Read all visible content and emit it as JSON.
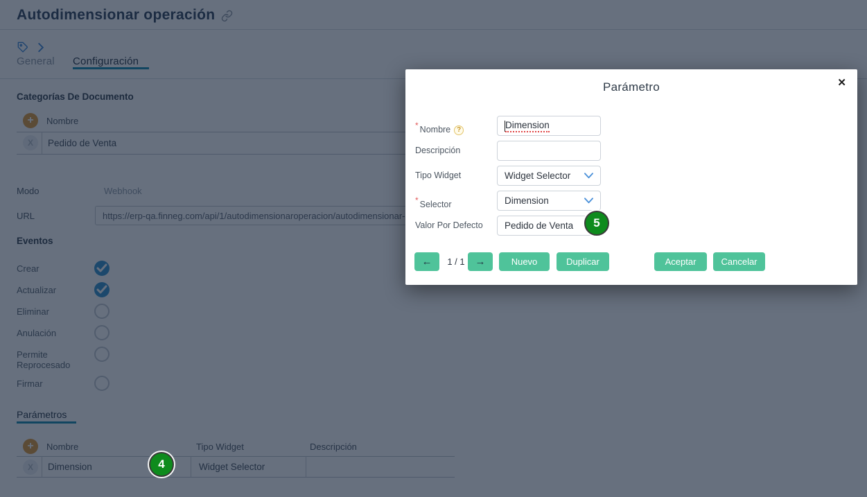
{
  "page": {
    "title": "Autodimensionar operación",
    "tabs": {
      "general": "General",
      "configuracion": "Configuración"
    },
    "doc_categories": {
      "section_title": "Categorías De Documento",
      "columns": {
        "nombre": "Nombre"
      },
      "rows": [
        {
          "nombre": "Pedido de Venta"
        }
      ]
    },
    "fields": {
      "modo_label": "Modo",
      "modo_value": "Webhook",
      "url_label": "URL",
      "url_value": "https://erp-qa.finneg.com/api/1/autodimensionaroperacion/autodimensionar-"
    },
    "eventos": {
      "section_title": "Eventos",
      "items": [
        {
          "label": "Crear",
          "checked": true
        },
        {
          "label": "Actualizar",
          "checked": true
        },
        {
          "label": "Eliminar",
          "checked": false
        },
        {
          "label": "Anulación",
          "checked": false
        },
        {
          "label": "Permite Reprocesado",
          "checked": false
        },
        {
          "label": "Firmar",
          "checked": false
        }
      ]
    },
    "parametros": {
      "section_title": "Parámetros",
      "columns": {
        "nombre": "Nombre",
        "tipo_widget": "Tipo Widget",
        "descripcion": "Descripción"
      },
      "rows": [
        {
          "nombre": "Dimension",
          "tipo_widget": "Widget Selector",
          "descripcion": ""
        }
      ]
    },
    "icons": {
      "plus": "+",
      "delete": "X"
    }
  },
  "modal": {
    "title": "Parámetro",
    "close_label": "✕",
    "required_marker": "*",
    "help_icon": "?",
    "fields": {
      "nombre": {
        "label": "Nombre",
        "value": "Dimension"
      },
      "descripcion": {
        "label": "Descripción",
        "value": ""
      },
      "tipo_widget": {
        "label": "Tipo Widget",
        "value": "Widget Selector"
      },
      "selector": {
        "label": "Selector",
        "value": "Dimension"
      },
      "valor_por_defecto": {
        "label": "Valor Por Defecto",
        "value": "Pedido de Venta"
      }
    },
    "pager": "1 / 1",
    "buttons": {
      "prev": "←",
      "next": "→",
      "nuevo": "Nuevo",
      "duplicar": "Duplicar",
      "aceptar": "Aceptar",
      "cancelar": "Cancelar"
    }
  },
  "annotations": {
    "badge4": "4",
    "badge5": "5"
  },
  "colors": {
    "accent_teal": "#2993b4",
    "button_green": "#4fc39a",
    "badge_green": "#0e8b1d",
    "checkbox_blue": "#449bd1",
    "plus_orange": "#e2a24b",
    "icon_blue": "#4a90d9",
    "backdrop": "rgba(2,16,40,0.6)"
  }
}
